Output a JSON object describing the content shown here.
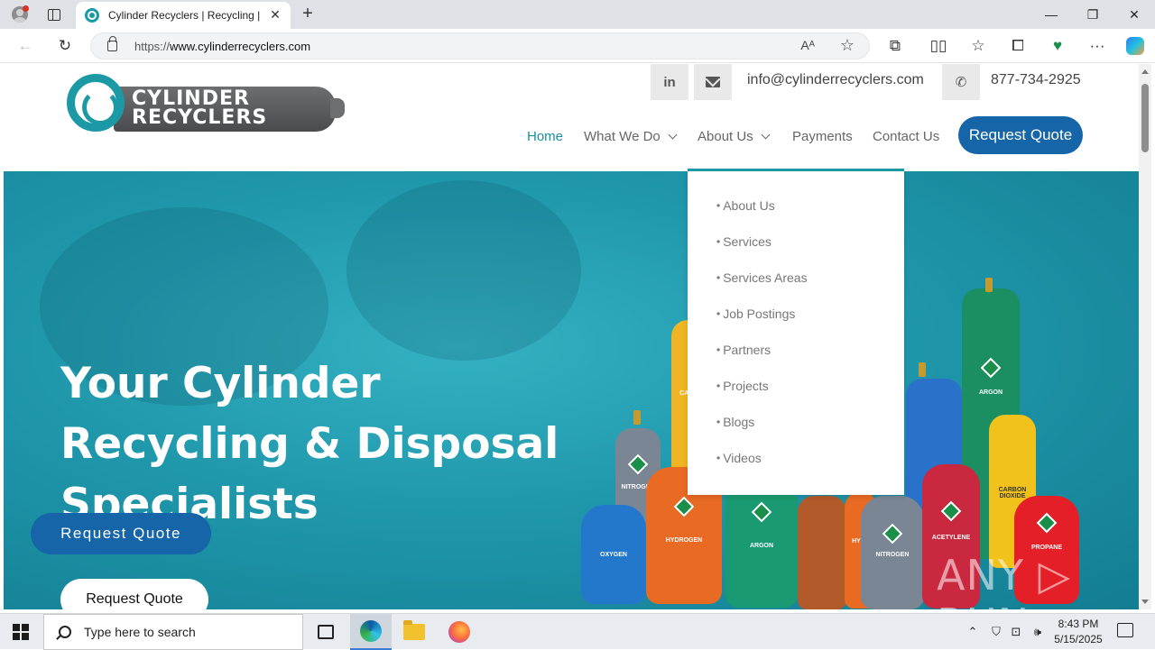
{
  "browser": {
    "tab_title": "Cylinder Recyclers | Recycling | D",
    "tab_close": "✕",
    "new_tab": "+",
    "url_protocol": "https://",
    "url_host": "www.cylinderrecyclers.com",
    "read_aloud": "Aᴬ",
    "favorite": "☆",
    "window_minimize": "—",
    "window_restore": "❐",
    "window_close": "✕",
    "toolbar_icons": [
      "back-icon",
      "refresh-icon",
      "extensions-icon",
      "split-screen-icon",
      "favorites-icon",
      "collections-icon",
      "performance-icon",
      "more-icon",
      "copilot-icon"
    ]
  },
  "site": {
    "logo_text": [
      "CYLINDER",
      "RECYCLERS"
    ],
    "linkedin": "in",
    "email": "info@cylinderrecyclers.com",
    "phone": "877-734-2925",
    "nav": {
      "home": "Home",
      "what_we_do": "What We Do",
      "about_us": "About Us",
      "payments": "Payments",
      "contact_us": "Contact Us",
      "request_quote": "Request Quote"
    },
    "about_dropdown": [
      "About Us",
      "Services",
      "Services Areas",
      "Job Postings",
      "Partners",
      "Projects",
      "Blogs",
      "Videos"
    ],
    "hero": {
      "headline": "Your Cylinder Recycling & Disposal Specialists",
      "button_primary": "Request Quote",
      "button_secondary": "Request Quote"
    },
    "cylinder_labels": [
      "NITROGEN",
      "OXYGEN",
      "HYDROGEN",
      "ARGON",
      "NITROGEN",
      "ACETYLENE",
      "PROPANE",
      "ARGON",
      "CARBON DIOXIDE",
      "CARBO",
      "OXY",
      "HYDR"
    ],
    "watermark": "ANY ▷ RUN"
  },
  "taskbar": {
    "search_placeholder": "Type here to search",
    "time": "8:43 PM",
    "date": "5/15/2025"
  },
  "colors": {
    "teal": "#1b9aa6",
    "brand_blue": "#1565a8",
    "nav_active": "#1b8fa0"
  }
}
